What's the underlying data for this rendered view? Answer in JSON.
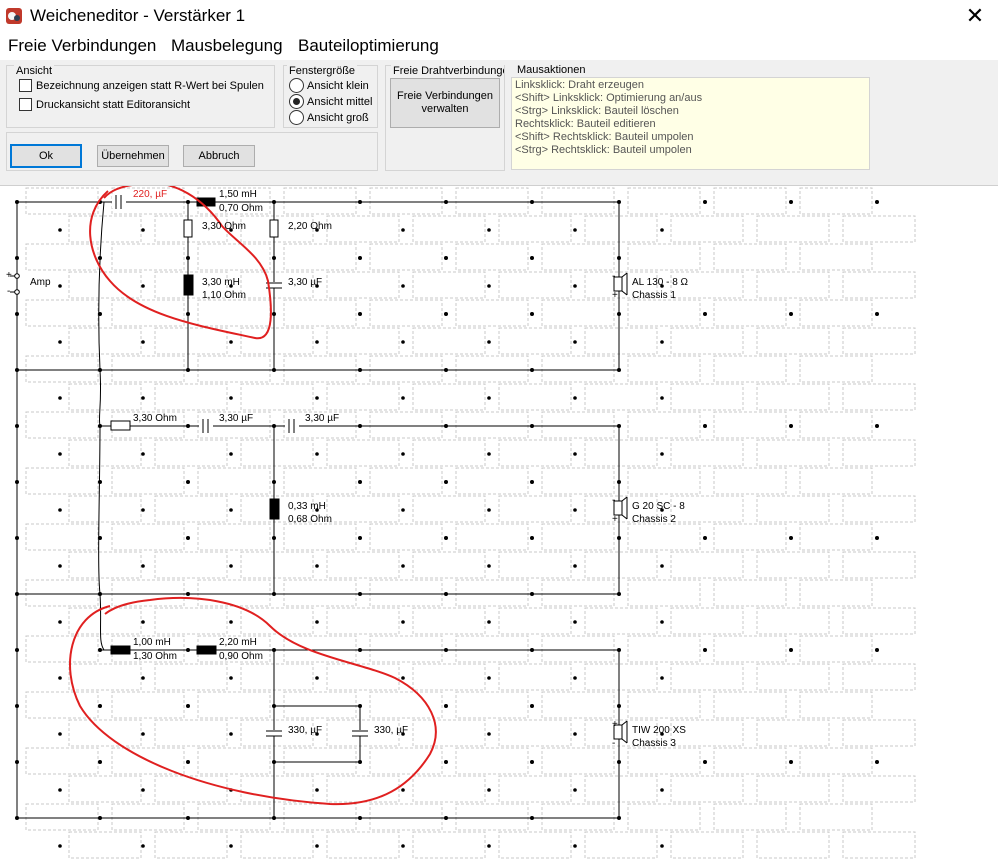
{
  "window": {
    "title": "Weicheneditor - Verstärker 1",
    "close_glyph": "✕"
  },
  "menu": {
    "items": [
      "Freie Verbindungen",
      "Mausbelegung",
      "Bauteiloptimierung"
    ]
  },
  "view_group": {
    "title": "Ansicht",
    "checkbox1": "Bezeichnung anzeigen statt R-Wert bei Spulen",
    "checkbox2": "Druckansicht statt Editoransicht"
  },
  "window_size_group": {
    "title": "Fenstergröße",
    "small": "Ansicht klein",
    "medium": "Ansicht mittel",
    "large": "Ansicht groß",
    "selected": "medium"
  },
  "free_wire_group": {
    "title": "Freie Drahtverbindungen",
    "manage_button": "Freie Verbindungen verwalten"
  },
  "buttons": {
    "ok": "Ok",
    "apply": "Übernehmen",
    "cancel": "Abbruch"
  },
  "mouse_actions": {
    "title": "Mausaktionen",
    "lines": [
      "Linksklick: Draht erzeugen",
      "<Shift> Linksklick: Optimierung an/aus",
      "<Strg> Linksklick: Bauteil löschen",
      "Rechtsklick: Bauteil editieren",
      " <Shift> Rechtsklick: Bauteil umpolen",
      "<Strg> Rechtsklick: Bauteil umpolen"
    ]
  },
  "schematic": {
    "amp_label": "Amp",
    "plus": "+",
    "minus": "-",
    "c1": "220, µF",
    "l1_ind": "1,50 mH",
    "l1_res": "0,70 Ohm",
    "r1": "3,30 Ohm",
    "r2": "2,20 Ohm",
    "l2_ind": "3,30 mH",
    "l2_res": "1,10 Ohm",
    "c2": "3,30 µF",
    "chassis1_name": "AL 130 - 8 Ω",
    "chassis1_label": "Chassis 1",
    "r3": "3,30 Ohm",
    "c3": "3,30 µF",
    "c4": "3,30 µF",
    "l3_ind": "0,33 mH",
    "l3_res": "0,68 Ohm",
    "chassis2_name": "G 20 SC - 8",
    "chassis2_label": "Chassis 2",
    "l4_ind": "1,00 mH",
    "l4_res": "1,30 Ohm",
    "l5_ind": "2,20 mH",
    "l5_res": "0,90 Ohm",
    "c5": "330, µF",
    "c6": "330, µF",
    "chassis3_name": "TIW 200 XS",
    "chassis3_label": "Chassis 3"
  },
  "colors": {
    "annotation": "#e02020",
    "accent": "#0078d7",
    "info_bg": "#ffffe6"
  }
}
